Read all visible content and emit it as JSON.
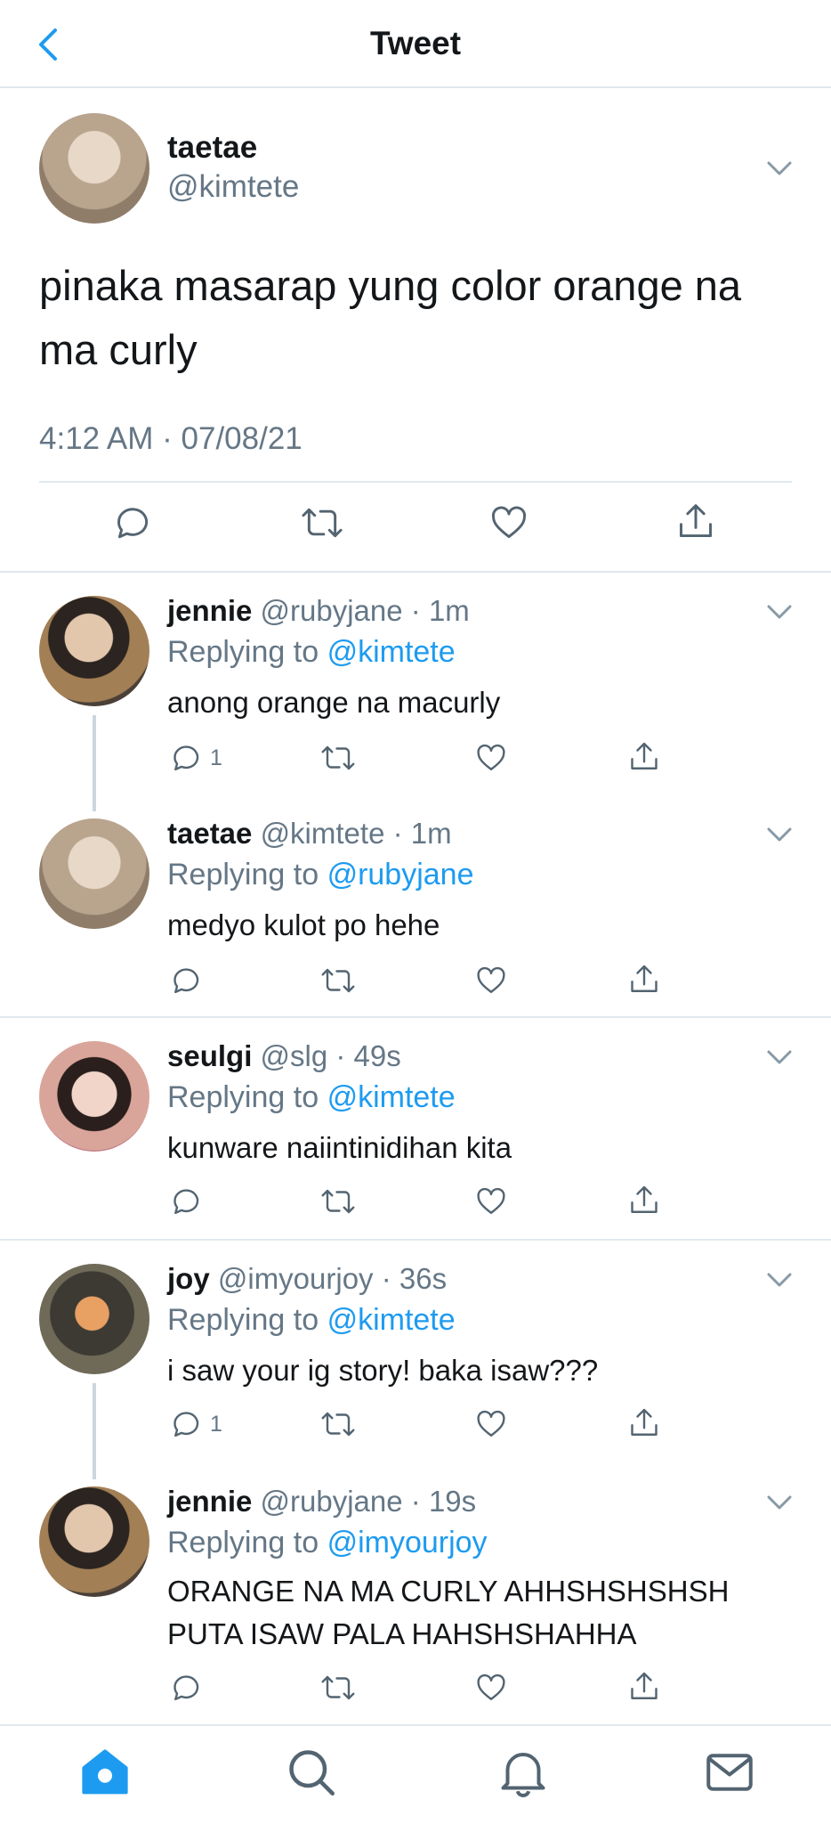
{
  "header": {
    "title": "Tweet",
    "back_icon": "chevron-left-icon"
  },
  "main_tweet": {
    "name": "taetae",
    "handle": "@kimtete",
    "text": "pinaka masarap yung color orange na ma curly",
    "timestamp": "4:12 AM · 07/08/21",
    "avatar_color": "#b9a48e"
  },
  "replies": [
    {
      "name": "jennie",
      "handle": "@rubyjane",
      "time": "· 1m",
      "replying_prefix": "Replying to",
      "replying_to": "@kimtete",
      "text": "anong orange na macurly",
      "reply_count": "1",
      "avatar_color": "#7a5b3f"
    },
    {
      "name": "taetae",
      "handle": "@kimtete",
      "time": "· 1m",
      "replying_prefix": "Replying to",
      "replying_to": "@rubyjane",
      "text": "medyo kulot po hehe",
      "reply_count": "",
      "avatar_color": "#b9a48e"
    },
    {
      "name": "seulgi",
      "handle": "@slg",
      "time": "· 49s",
      "replying_prefix": "Replying to",
      "replying_to": "@kimtete",
      "text": "kunware naiintinidihan kita",
      "reply_count": "",
      "avatar_color": "#d9a59a"
    },
    {
      "name": "joy",
      "handle": "@imyourjoy",
      "time": "· 36s",
      "replying_prefix": "Replying to",
      "replying_to": "@kimtete",
      "text": "i saw your ig story! baka isaw???",
      "reply_count": "1",
      "avatar_color": "#5a5148"
    },
    {
      "name": "jennie",
      "handle": "@rubyjane",
      "time": "· 19s",
      "replying_prefix": "Replying to",
      "replying_to": "@imyourjoy",
      "text": "ORANGE NA MA CURLY AHHSHSHSHSH\nPUTA ISAW PALA HAHSHSHAHHA",
      "reply_count": "",
      "avatar_color": "#7a5b3f"
    }
  ],
  "tabs": [
    "home-icon",
    "search-icon",
    "bell-icon",
    "mail-icon"
  ],
  "colors": {
    "accent": "#1d9bf0",
    "secondary_text": "#657786",
    "divider": "#e1e8ed",
    "tab_active": "#1d9bf0"
  }
}
